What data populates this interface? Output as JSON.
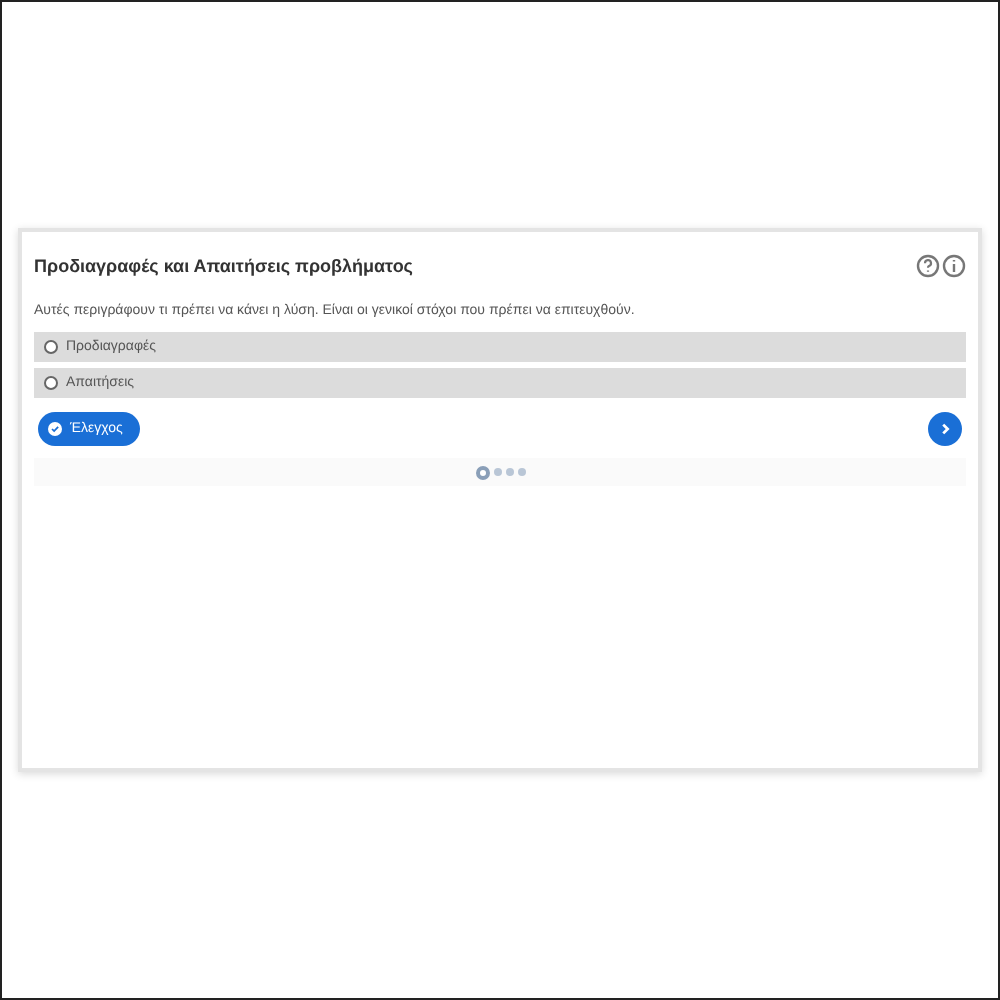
{
  "card": {
    "title": "Προδιαγραφές και Απαιτήσεις προβλήματος",
    "description": "Αυτές περιγράφουν τι πρέπει να κάνει η λύση. Είναι οι γενικοί στόχοι που πρέπει να επιτευχθούν.",
    "options": [
      {
        "label": "Προδιαγραφές",
        "selected": false
      },
      {
        "label": "Απαιτήσεις",
        "selected": false
      }
    ],
    "check_button": "Έλεγχος",
    "pages": [
      {
        "selected": true
      },
      {
        "selected": false
      },
      {
        "selected": false
      },
      {
        "selected": false
      }
    ]
  }
}
